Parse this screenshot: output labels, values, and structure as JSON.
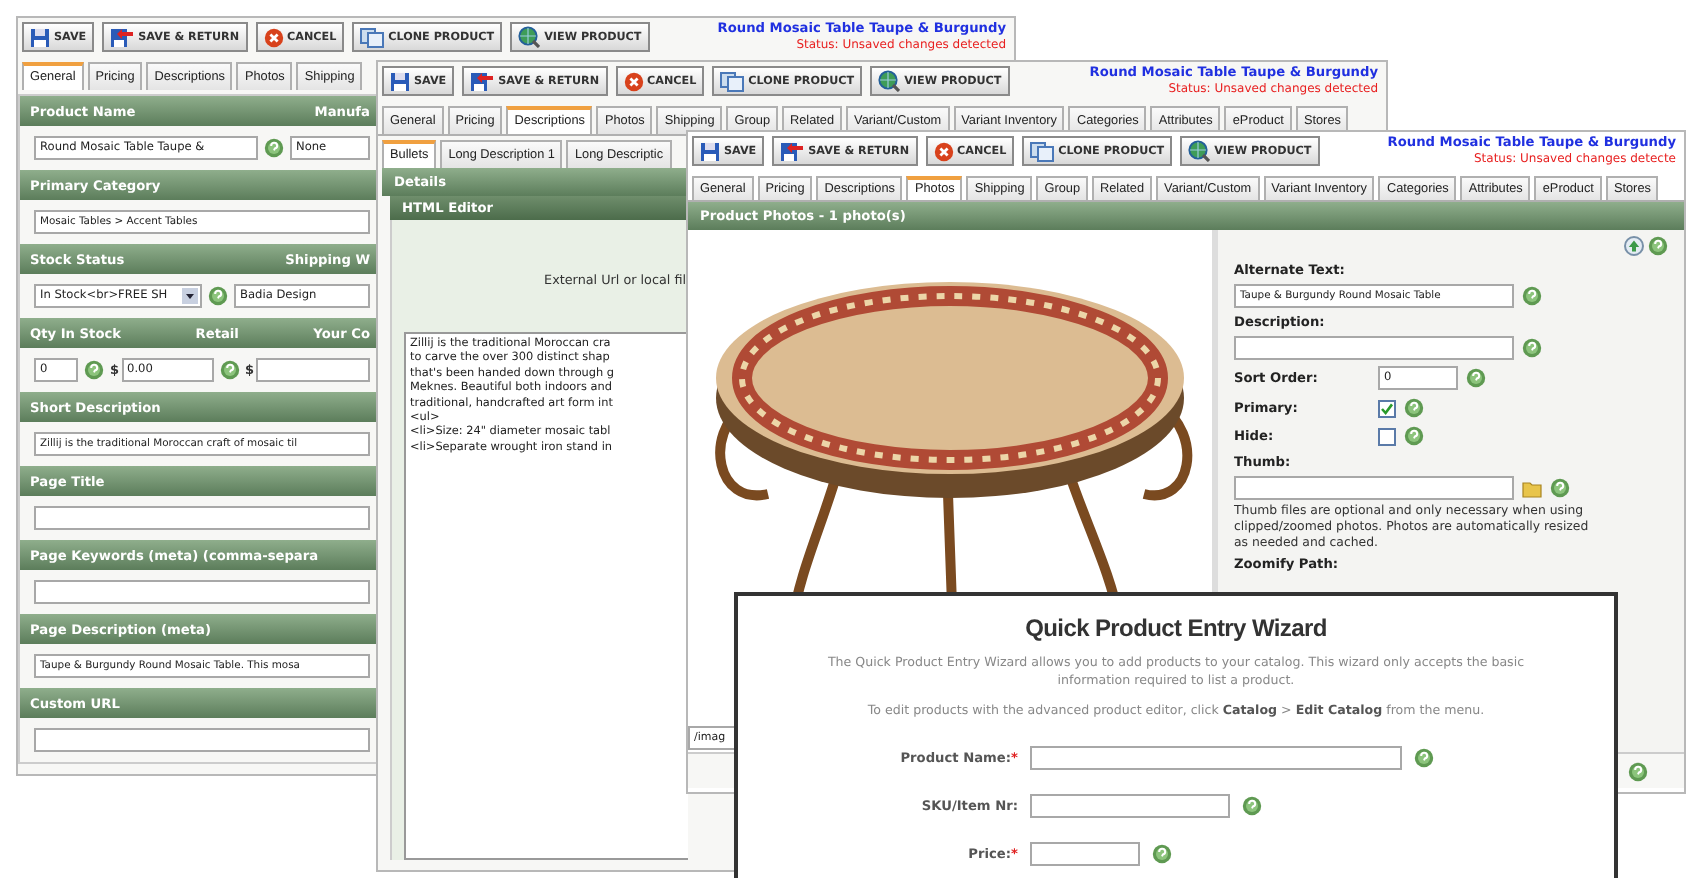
{
  "general_window": {
    "toolbar": [
      {
        "kind": "save",
        "label": "SAVE"
      },
      {
        "kind": "save_return",
        "label": "SAVE & RETURN"
      },
      {
        "kind": "cancel",
        "label": "CANCEL"
      },
      {
        "kind": "clone",
        "label": "CLONE PRODUCT"
      },
      {
        "kind": "view",
        "label": "VIEW PRODUCT"
      }
    ],
    "title": "Round Mosaic Table Taupe & Burgundy",
    "status": "Status: Unsaved changes detected",
    "tabs": [
      {
        "label": "General",
        "selected": true
      },
      {
        "label": "Pricing",
        "selected": false
      },
      {
        "label": "Descriptions",
        "selected": false
      },
      {
        "label": "Photos",
        "selected": false
      },
      {
        "label": "Shipping",
        "selected": false
      }
    ],
    "sections": [
      {
        "headings": [
          "Product Name",
          "Manufa"
        ],
        "fields": [
          {
            "kind": "text",
            "value": "Round Mosaic Table Taupe &"
          },
          {
            "kind": "help"
          },
          {
            "kind": "short",
            "value": "None"
          }
        ]
      },
      {
        "headings": [
          "Primary Category"
        ],
        "fields": [
          {
            "kind": "wide",
            "value": "Mosaic Tables > Accent Tables"
          }
        ]
      },
      {
        "headings": [
          "Stock Status",
          "Shipping W"
        ],
        "fields": [
          {
            "kind": "select",
            "value": "In Stock<br>FREE SH"
          },
          {
            "kind": "help"
          },
          {
            "kind": "text",
            "value": "Badia Design"
          }
        ]
      },
      {
        "headings": [
          "Qty In Stock",
          "Retail",
          "Your Co"
        ],
        "fields": [
          {
            "kind": "number",
            "value": "0"
          },
          {
            "kind": "help"
          },
          {
            "kind": "currency",
            "symbol": "$",
            "value": "0.00"
          },
          {
            "kind": "help"
          },
          {
            "kind": "currency",
            "symbol": "$"
          }
        ]
      },
      {
        "headings": [
          "Short Description"
        ],
        "fields": [
          {
            "kind": "wide",
            "value": "Zillij is the traditional Moroccan craft of mosaic til"
          }
        ]
      },
      {
        "headings": [
          "Page Title"
        ],
        "fields": [
          {
            "kind": "wide"
          }
        ]
      },
      {
        "headings": [
          "Page Keywords (meta) (comma-separa"
        ],
        "fields": [
          {
            "kind": "wide"
          }
        ]
      },
      {
        "headings": [
          "Page Description (meta)"
        ],
        "fields": [
          {
            "kind": "wide",
            "value": "Taupe & Burgundy Round Mosaic Table. This mosa"
          }
        ]
      },
      {
        "headings": [
          "Custom URL"
        ],
        "fields": [
          {
            "kind": "wide"
          }
        ]
      }
    ]
  },
  "descriptions_window": {
    "toolbar": [
      {
        "kind": "save",
        "label": "SAVE"
      },
      {
        "kind": "save_return",
        "label": "SAVE & RETURN"
      },
      {
        "kind": "cancel",
        "label": "CANCEL"
      },
      {
        "kind": "clone",
        "label": "CLONE PRODUCT"
      },
      {
        "kind": "view",
        "label": "VIEW PRODUCT"
      }
    ],
    "title": "Round Mosaic Table Taupe & Burgundy",
    "status": "Status: Unsaved changes detected",
    "tabs": [
      {
        "label": "General",
        "selected": false
      },
      {
        "label": "Pricing",
        "selected": false
      },
      {
        "label": "Descriptions",
        "selected": true
      },
      {
        "label": "Photos",
        "selected": false
      },
      {
        "label": "Shipping",
        "selected": false
      },
      {
        "label": "Group",
        "selected": false
      },
      {
        "label": "Related",
        "selected": false
      },
      {
        "label": "Variant/Custom",
        "selected": false
      },
      {
        "label": "Variant Inventory",
        "selected": false
      },
      {
        "label": "Categories",
        "selected": false
      },
      {
        "label": "Attributes",
        "selected": false
      },
      {
        "label": "eProduct",
        "selected": false
      },
      {
        "label": "Stores",
        "selected": false
      }
    ],
    "subtabs": [
      {
        "label": "Bullets",
        "selected": true
      },
      {
        "label": "Long Description 1",
        "selected": false
      },
      {
        "label": "Long Descriptic",
        "selected": false
      }
    ],
    "panel_title": "Details",
    "editor_title": "HTML Editor",
    "url_label": "External Url or local fil",
    "editor_text": "Zillij is the traditional Moroccan cra\nto carve the over 300 distinct shap\nthat's been handed down through g\nMeknes. Beautiful both indoors and\ntraditional, handcrafted art form int\n<ul>\n<li>Size: 24\" diameter mosaic tabl\n<li>Separate wrought iron stand in"
  },
  "photos_window": {
    "toolbar": [
      {
        "kind": "save",
        "label": "SAVE"
      },
      {
        "kind": "save_return",
        "label": "SAVE & RETURN"
      },
      {
        "kind": "cancel",
        "label": "CANCEL"
      },
      {
        "kind": "clone",
        "label": "CLONE PRODUCT"
      },
      {
        "kind": "view",
        "label": "VIEW PRODUCT"
      }
    ],
    "title": "Round Mosaic Table Taupe & Burgundy",
    "status": "Status: Unsaved changes detecte",
    "tabs": [
      {
        "label": "General",
        "selected": false
      },
      {
        "label": "Pricing",
        "selected": false
      },
      {
        "label": "Descriptions",
        "selected": false
      },
      {
        "label": "Photos",
        "selected": true
      },
      {
        "label": "Shipping",
        "selected": false
      },
      {
        "label": "Group",
        "selected": false
      },
      {
        "label": "Related",
        "selected": false
      },
      {
        "label": "Variant/Custom",
        "selected": false
      },
      {
        "label": "Variant Inventory",
        "selected": false
      },
      {
        "label": "Categories",
        "selected": false
      },
      {
        "label": "Attributes",
        "selected": false
      },
      {
        "label": "eProduct",
        "selected": false
      },
      {
        "label": "Stores",
        "selected": false
      }
    ],
    "header": "Product Photos - 1 photo(s)",
    "path_value": "/imag",
    "fields": [
      {
        "kind": "stacked",
        "label": "Alternate Text:",
        "value": "Taupe & Burgundy Round Mosaic Table"
      },
      {
        "kind": "stacked",
        "label": "Description:"
      },
      {
        "kind": "inline",
        "label": "Sort Order:",
        "value": "0"
      },
      {
        "kind": "checkbox",
        "label": "Primary:",
        "checked": true
      },
      {
        "kind": "checkbox",
        "label": "Hide:",
        "checked": false
      },
      {
        "kind": "file",
        "label": "Thumb:",
        "note": "Thumb files are optional and only necessary when using clipped/zoomed photos. Photos are automatically resized as needed and cached."
      },
      {
        "kind": "heading",
        "label": "Zoomify Path:"
      }
    ]
  },
  "wizard_dialog": {
    "title": "Quick Product Entry Wizard",
    "intro": "The Quick Product Entry Wizard allows you to add products to your catalog. This wizard only accepts the basic information required to list a product.",
    "edit_hint": "To edit products with the advanced product editor, click **Catalog** > **Edit Catalog** from the menu.",
    "fields": [
      {
        "kind": "long",
        "label": "Product Name:",
        "required_mark": "*"
      },
      {
        "kind": "medium",
        "label": "SKU/Item Nr:"
      },
      {
        "kind": "short",
        "label": "Price:",
        "required_mark": "*"
      }
    ]
  }
}
